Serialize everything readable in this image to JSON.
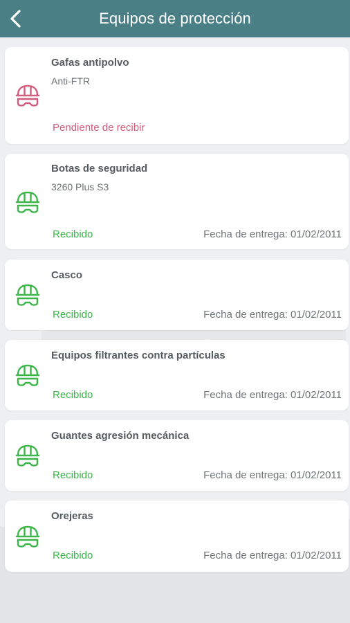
{
  "header": {
    "title": "Equipos de protección",
    "back_icon": "chevron-left-icon",
    "color": "#4a7f86"
  },
  "colors": {
    "pending": "#d35b7c",
    "received": "#3cb549",
    "background": "#eeeff0"
  },
  "items": [
    {
      "name": "Gafas antipolvo",
      "model": "Anti-FTR",
      "status": "Pendiente de recibir",
      "date": "",
      "icon": "hardhat-goggles-icon"
    },
    {
      "name": "Botas de seguridad",
      "model": "3260 Plus S3",
      "status": "Recibido",
      "date": "Fecha de entrega: 01/02/2011",
      "icon": "hardhat-goggles-icon"
    },
    {
      "name": "Casco",
      "model": "",
      "status": "Recibido",
      "date": "Fecha de entrega: 01/02/2011",
      "icon": "hardhat-goggles-icon"
    },
    {
      "name": "Equipos filtrantes contra partículas",
      "model": "",
      "status": "Recibido",
      "date": "Fecha de entrega: 01/02/2011",
      "icon": "hardhat-goggles-icon"
    },
    {
      "name": "Guantes agresión mecánica",
      "model": "",
      "status": "Recibido",
      "date": "Fecha de entrega: 01/02/2011",
      "icon": "hardhat-goggles-icon"
    },
    {
      "name": "Orejeras",
      "model": "",
      "status": "Recibido",
      "date": "Fecha de entrega: 01/02/2011",
      "icon": "hardhat-goggles-icon"
    }
  ]
}
